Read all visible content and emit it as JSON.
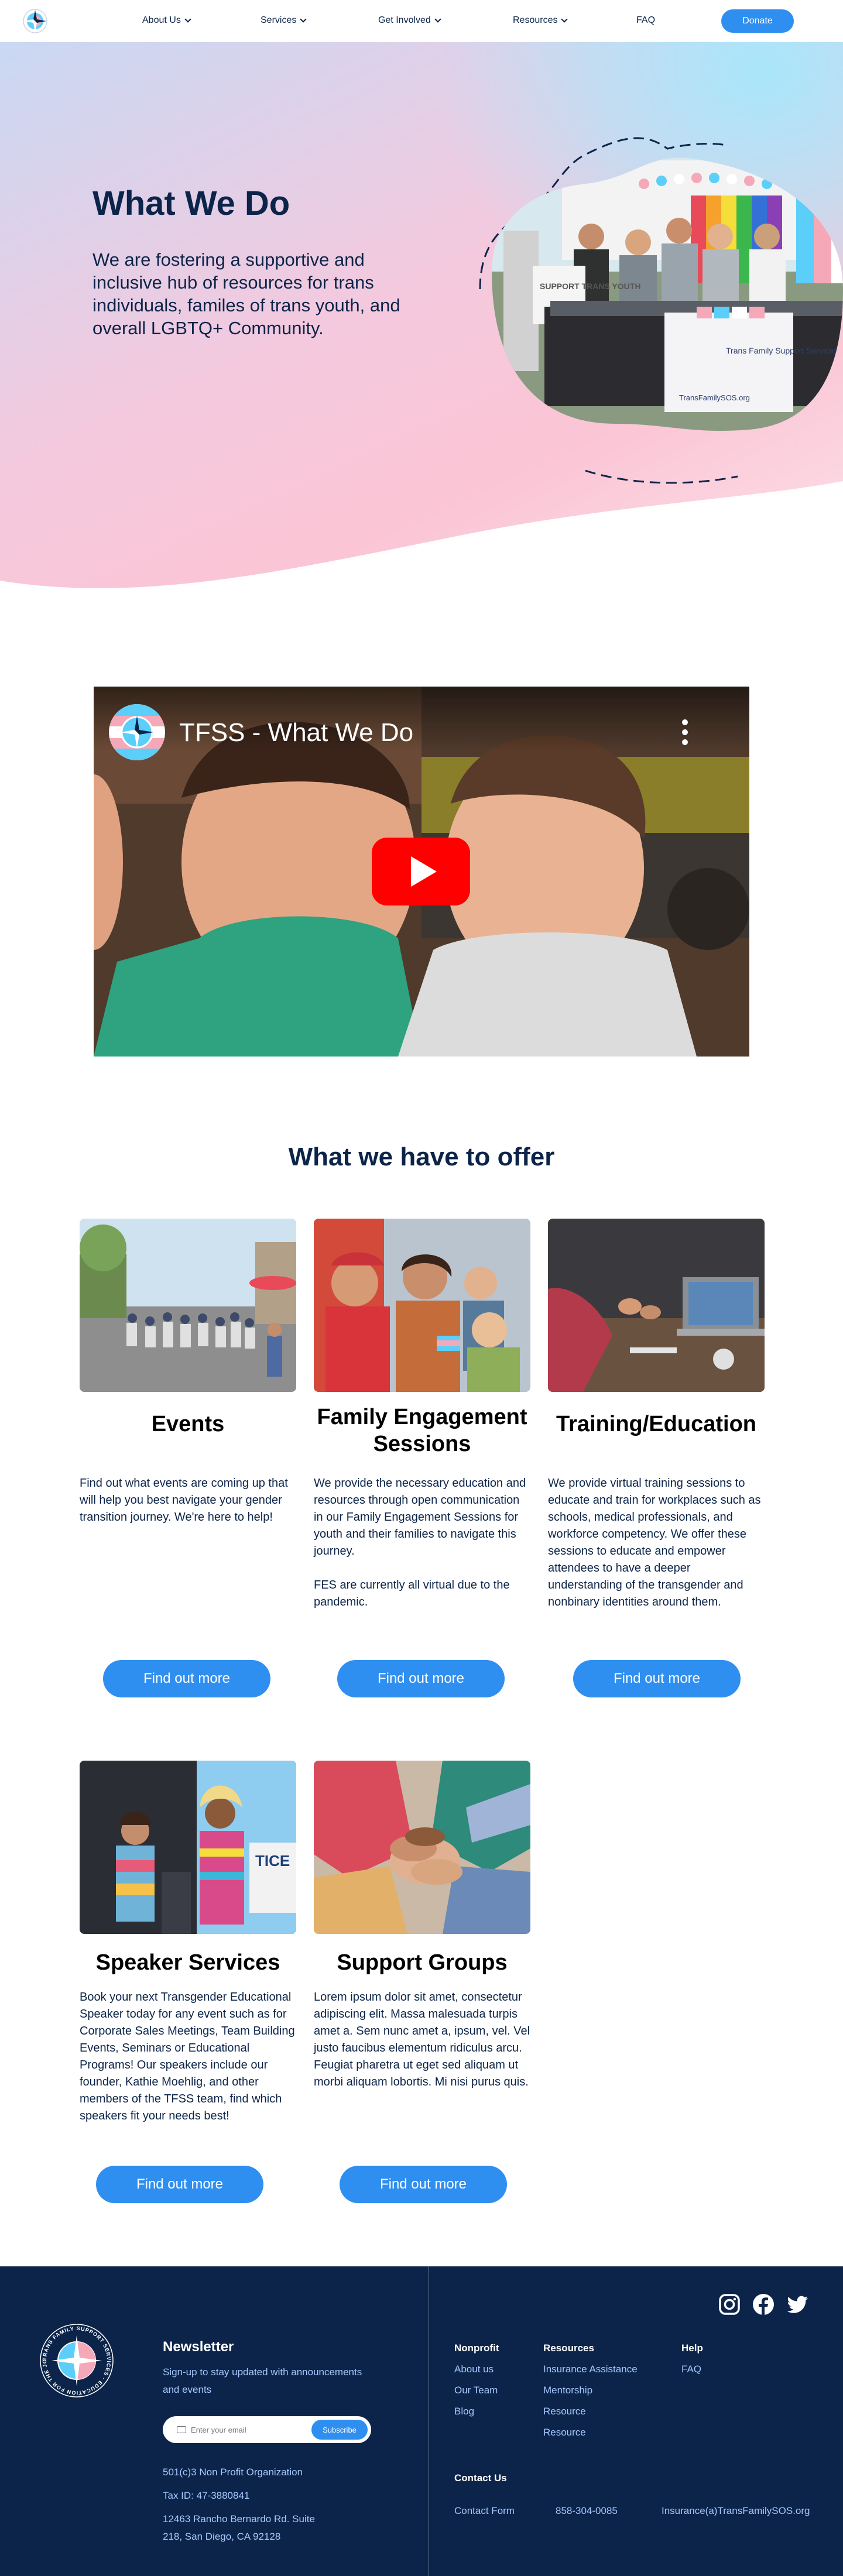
{
  "nav": {
    "items": [
      {
        "label": "About Us"
      },
      {
        "label": "Services"
      },
      {
        "label": "Get Involved"
      },
      {
        "label": "Resources"
      },
      {
        "label": "FAQ"
      }
    ],
    "donate_label": "Donate"
  },
  "hero": {
    "title": "What We Do",
    "text": "We are fostering a supportive and inclusive hub of resources for trans individuals, familes of trans youth, and overall LGBTQ+ Community.",
    "photo_banner_text": "Trans Family Support Services",
    "photo_url_text": "TransFamilySOS.org",
    "photo_sign_text": "SUPPORT TRANS YOUTH"
  },
  "video": {
    "title": "TFSS - What We Do"
  },
  "offers": {
    "title": "What we have to offer",
    "cards": [
      {
        "title": "Events",
        "text": "Find out what events are coming up that will help you best navigate your gender transition journey. We're here to help!",
        "button": "Find out more"
      },
      {
        "title": "Family Engagement Sessions",
        "text": "We provide the necessary education and resources through open communication in our Family Engagement Sessions for youth and their families to navigate this journey.\n\nFES are currently all virtual due to the pandemic.",
        "button": "Find out more"
      },
      {
        "title": "Training/Education",
        "text": "We provide virtual training sessions to educate and train for workplaces such as schools, medical professionals, and workforce competency. We offer these sessions to educate and empower attendees to have a deeper understanding of the transgender and nonbinary identities around them.",
        "button": "Find out more"
      },
      {
        "title": "Speaker Services",
        "text": "Book your next Transgender Educational Speaker today for any event such as for Corporate Sales Meetings, Team Building Events, Seminars or Educational Programs! Our speakers include our founder, Kathie Moehlig, and other members of the TFSS team, find which speakers fit your needs best!",
        "button": "Find out more"
      },
      {
        "title": "Support Groups",
        "text": "Lorem ipsum dolor sit amet, consectetur adipiscing elit. Massa malesuada turpis amet a. Sem nunc amet a, ipsum, vel. Vel justo faucibus elementum ridiculus arcu. Feugiat pharetra ut eget sed aliquam ut morbi aliquam lobortis. Mi nisi purus quis.",
        "button": "Find out more"
      }
    ],
    "speaker_sign_text": "TICE"
  },
  "footer": {
    "logo_ring_text": "TRANS FAMILY SUPPORT SERVICES · EDUCATION FOR THE JOURNEY",
    "newsletter_title": "Newsletter",
    "newsletter_text": "Sign-up to stay updated with announcements and events",
    "email_placeholder": "Enter your email",
    "subscribe_label": "Subscribe",
    "org_type": "501(c)3 Non Profit Organization",
    "tax_id": "Tax ID: 47-3880841",
    "address_line1": "12463 Rancho Bernardo Rd. Suite",
    "address_line2": "218, San Diego, CA 92128",
    "nonprofit_head": "Nonprofit",
    "nonprofit_links": [
      "About us",
      "Our Team",
      "Blog"
    ],
    "resources_head": "Resources",
    "resources_links": [
      "Insurance Assistance",
      "Mentorship",
      "Resource",
      "Resource"
    ],
    "help_head": "Help",
    "help_links": [
      "FAQ"
    ],
    "contact_head": "Contact Us",
    "contact_form": "Contact Form",
    "phone": "858-304-0085",
    "email": "Insurance(a)TransFamilySOS.org"
  },
  "colors": {
    "navy": "#0c2449",
    "accent_blue": "#2f8ff0",
    "link_blue": "#a6c8ff",
    "trans_blue": "#5bcefa",
    "trans_pink": "#f5a9b8"
  },
  "icons": [
    "compass-logo-icon",
    "chevron-down-icon",
    "play-icon",
    "more-vert-icon",
    "mail-icon",
    "instagram-icon",
    "facebook-icon",
    "twitter-icon"
  ]
}
